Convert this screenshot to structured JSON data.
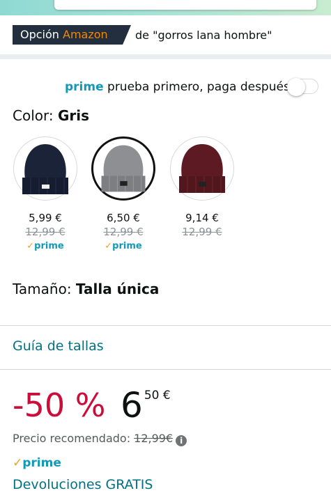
{
  "choice": {
    "prefix": "Opción ",
    "brand": "Amazon",
    "query": "de \"gorros lana hombre\""
  },
  "prime_try": {
    "prime": "prime",
    "text": " prueba primero, paga después",
    "toggle_on": false
  },
  "color": {
    "label": "Color: ",
    "value": "Gris"
  },
  "swatches": [
    {
      "name": "navy",
      "color": "#1a2338",
      "price": "5,99 €",
      "old_price": "12,99 €",
      "check": "✓",
      "prime": "prime",
      "selected": false
    },
    {
      "name": "gray",
      "color": "#8e8f93",
      "price": "6,50 €",
      "old_price": "12,99 €",
      "check": "✓",
      "prime": "prime",
      "selected": true
    },
    {
      "name": "burgundy",
      "color": "#5e1a22",
      "price": "9,14 €",
      "old_price": "12,99 €",
      "selected": false
    }
  ],
  "size": {
    "label": "Tamaño: ",
    "value": "Talla única"
  },
  "size_guide": "Guía de tallas",
  "price": {
    "discount": "-50 %",
    "whole": "6",
    "fraction": "50 €",
    "recommended_label": "Precio recomendado: ",
    "recommended_old": "12,99€",
    "info": "i"
  },
  "delivery": {
    "check": "✓",
    "prime": "prime",
    "returns": "Devoluciones GRATIS"
  },
  "colors": {
    "prime_blue": "#1399b8",
    "link": "#007185",
    "discount_red": "#cc0c39",
    "badge_dark": "#232f3e",
    "badge_orange": "#f08804"
  }
}
